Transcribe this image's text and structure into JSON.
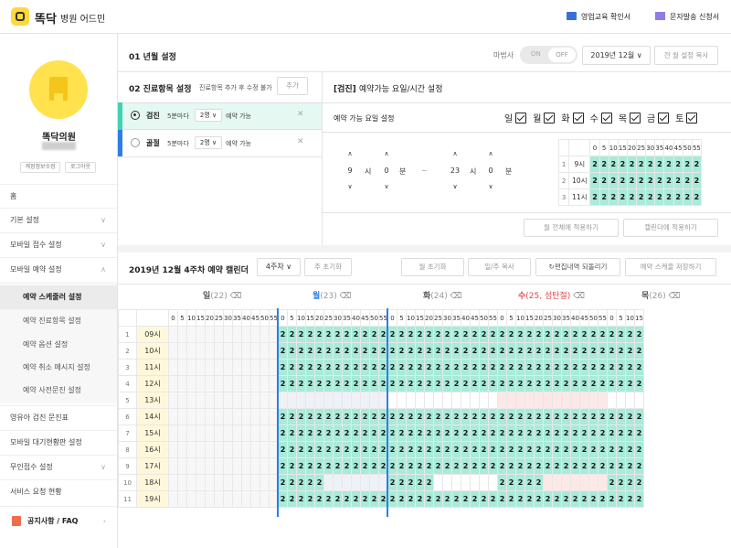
{
  "brand": {
    "name": "똑닥",
    "subtitle": "병원 어드민"
  },
  "top_links": {
    "sales": "영업교육 확인서",
    "sms": "문자발송 신청서"
  },
  "clinic": {
    "name": "똑닥의원",
    "edit_btn": "계정정보수정",
    "logout_btn": "로그아웃"
  },
  "nav": {
    "home": "홈",
    "basic": "기본 설정",
    "mobile_receipt": "모바일 접수 설정",
    "mobile_reservation": "모바일 예약 설정",
    "sub": [
      "예약 스케줄러 설정",
      "예약 진료항목 설정",
      "예약 옵션 설정",
      "예약 취소 메시지 설정",
      "예약 사전문진 설정"
    ],
    "infant": "영유아 검진 문진표",
    "waiting": "모바일 대기현황판 설정",
    "unmanned": "무인접수 설정",
    "service": "서비스 요청 현황",
    "faq": "공지사항 / FAQ"
  },
  "year": {
    "title": "01 년월 설정",
    "magic_label": "마법사",
    "on": "ON",
    "off": "OFF",
    "month": "2019년 12월",
    "copy_btn": "전 월 설정 복사"
  },
  "items": {
    "title": "02 진료항목 설정",
    "hint": "진료항목 추가 후 수정 불가",
    "add_btn": "추가",
    "rows": [
      {
        "name": "검진",
        "interval": "5분마다",
        "count": "2명",
        "avail": "예약 가능",
        "color": "#3fd3b2"
      },
      {
        "name": "골절",
        "interval": "5분마다",
        "count": "2명",
        "avail": "예약 가능",
        "color": "#2d7fe6"
      }
    ]
  },
  "weekday": {
    "title_tag": "[검진]",
    "title": "예약가능 요일/시간 설정",
    "label": "예약 가능 요일 설정",
    "days": [
      "일",
      "월",
      "화",
      "수",
      "목",
      "금",
      "토"
    ],
    "start_h": "9",
    "start_m": "0",
    "end_h": "23",
    "end_m": "0",
    "h_unit": "시",
    "m_unit": "분",
    "sep": "~",
    "minutes": [
      "0",
      "5",
      "10",
      "15",
      "20",
      "25",
      "30",
      "35",
      "40",
      "45",
      "50",
      "55"
    ],
    "rows": [
      {
        "no": "1",
        "hour": "9시"
      },
      {
        "no": "2",
        "hour": "10시"
      },
      {
        "no": "3",
        "hour": "11시"
      }
    ],
    "cell": "2",
    "apply_month": "월 전체에 적용하기",
    "apply_cal": "캘린더에 적용하기"
  },
  "calendar": {
    "title": "2019년 12월 4주차 예약 캘린더",
    "week": "4주차",
    "week_reset": "주 초기화",
    "month_reset": "월 초기화",
    "week_copy": "일/주 복사",
    "undo": "편집내역 되돌리기",
    "save": "예약 스케줄 저장하기",
    "days": [
      {
        "label": "일",
        "date": "(22)",
        "color": "#555"
      },
      {
        "label": "월",
        "date": "(23)",
        "color": "#2d7fe6"
      },
      {
        "label": "화",
        "date": "(24)",
        "color": "#555"
      },
      {
        "label": "수",
        "date": "(25, 성탄절)",
        "color": "#e04848"
      },
      {
        "label": "목",
        "date": "(26)",
        "color": "#555"
      }
    ],
    "hours": [
      {
        "no": "1",
        "h": "09시"
      },
      {
        "no": "2",
        "h": "10시"
      },
      {
        "no": "3",
        "h": "11시"
      },
      {
        "no": "4",
        "h": "12시"
      },
      {
        "no": "5",
        "h": "13시"
      },
      {
        "no": "6",
        "h": "14시"
      },
      {
        "no": "7",
        "h": "15시"
      },
      {
        "no": "8",
        "h": "16시"
      },
      {
        "no": "9",
        "h": "17시"
      },
      {
        "no": "10",
        "h": "18시"
      },
      {
        "no": "11",
        "h": "19시"
      }
    ],
    "blank_hour_index": 4,
    "short_hour_index": 9
  }
}
